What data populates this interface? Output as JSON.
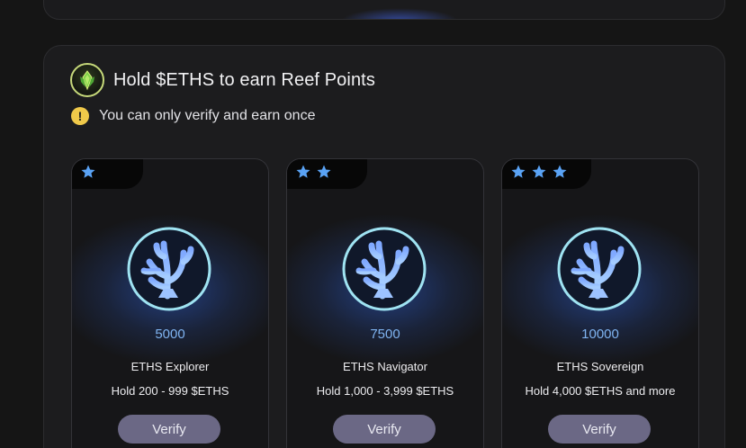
{
  "section": {
    "title": "Hold $ETHS to earn Reef Points",
    "note": "You can only verify and earn once"
  },
  "colors": {
    "accent_blue": "#7fb3f0",
    "star": "#5aa3f5",
    "button": "#6b6885",
    "warning": "#f0c94a",
    "brand_ring": "#c6d97a"
  },
  "icons": {
    "brand": "crystal-leaf-icon",
    "warning": "exclamation-icon",
    "star": "star-icon",
    "emblem": "coral-icon"
  },
  "cards": [
    {
      "stars": 1,
      "points": "5000",
      "name": "ETHS Explorer",
      "requirement": "Hold 200 - 999 $ETHS",
      "button": "Verify"
    },
    {
      "stars": 2,
      "points": "7500",
      "name": "ETHS Navigator",
      "requirement": "Hold 1,000 - 3,999 $ETHS",
      "button": "Verify"
    },
    {
      "stars": 3,
      "points": "10000",
      "name": "ETHS Sovereign",
      "requirement": "Hold 4,000 $ETHS and more",
      "button": "Verify"
    }
  ]
}
